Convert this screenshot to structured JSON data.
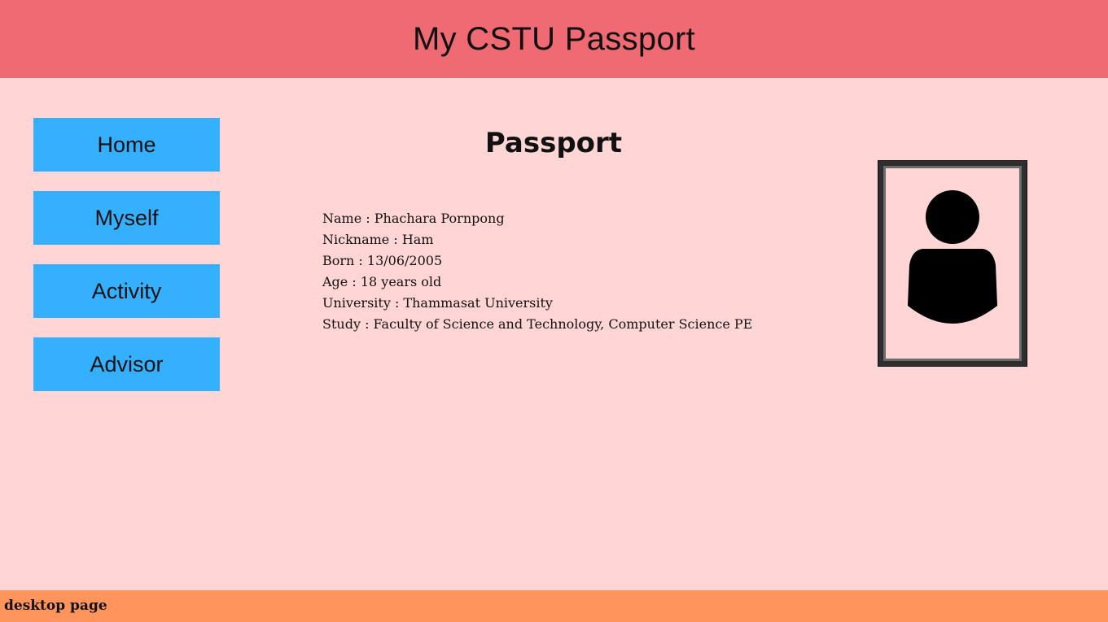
{
  "header": {
    "title": "My CSTU Passport"
  },
  "sidebar": {
    "items": [
      {
        "label": "Home"
      },
      {
        "label": "Myself"
      },
      {
        "label": "Activity"
      },
      {
        "label": "Advisor"
      }
    ]
  },
  "main": {
    "heading": "Passport",
    "info": [
      "Name : Phachara Pornpong",
      "Nickname : Ham",
      "Born : 13/06/2005",
      "Age : 18 years old",
      "University : Thammasat University",
      "Study : Faculty of Science and Technology, Computer Science PE"
    ],
    "photo_icon": "user-avatar-icon"
  },
  "footer": {
    "text": "desktop page"
  },
  "colors": {
    "header_bg": "#ef6a72",
    "page_bg": "#ffd5d5",
    "nav_button_bg": "#35b0ff",
    "footer_bg": "#ff945c",
    "frame_border": "#2e2e2e"
  }
}
